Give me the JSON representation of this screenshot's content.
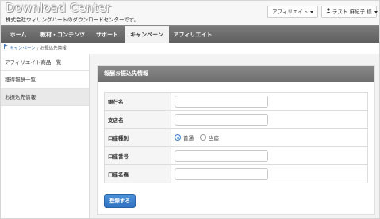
{
  "header": {
    "logo": "Download Center",
    "tagline": "株式会社ウィリングハートのダウンロードセンターです。",
    "affiliate_button": "アフィリエイト",
    "user_button": "テスト 麻紀子 様"
  },
  "nav": {
    "items": [
      {
        "label": "ホーム"
      },
      {
        "label": "教材・コンテンツ"
      },
      {
        "label": "サポート"
      },
      {
        "label": "キャンペーン"
      },
      {
        "label": "アフィリエイト"
      }
    ],
    "active_index": 3
  },
  "breadcrumb": {
    "items": [
      "キャンペーン",
      "お振込先情報"
    ]
  },
  "sidebar": {
    "items": [
      {
        "label": "アフィリエイト商品一覧"
      },
      {
        "label": "獲得報酬一覧"
      },
      {
        "label": "お振込先情報"
      }
    ],
    "active_index": 2
  },
  "panel": {
    "title": "報酬お振込先情報",
    "fields": [
      {
        "label": "銀行名",
        "value": "",
        "placeholder": ""
      },
      {
        "label": "支店名",
        "value": "",
        "placeholder": ""
      },
      {
        "label": "口座種別"
      },
      {
        "label": "口座番号",
        "value": "",
        "placeholder": ""
      },
      {
        "label": "口座名義",
        "value": "",
        "placeholder": ""
      }
    ],
    "account_type_options": [
      "普通",
      "当座"
    ],
    "account_type_selected": "普通",
    "submit_label": "登録する"
  },
  "colors": {
    "nav_bg": "#6a6a6a",
    "accent_blue": "#3a7bd5",
    "panel_title_bg": "#7c7c7c"
  }
}
